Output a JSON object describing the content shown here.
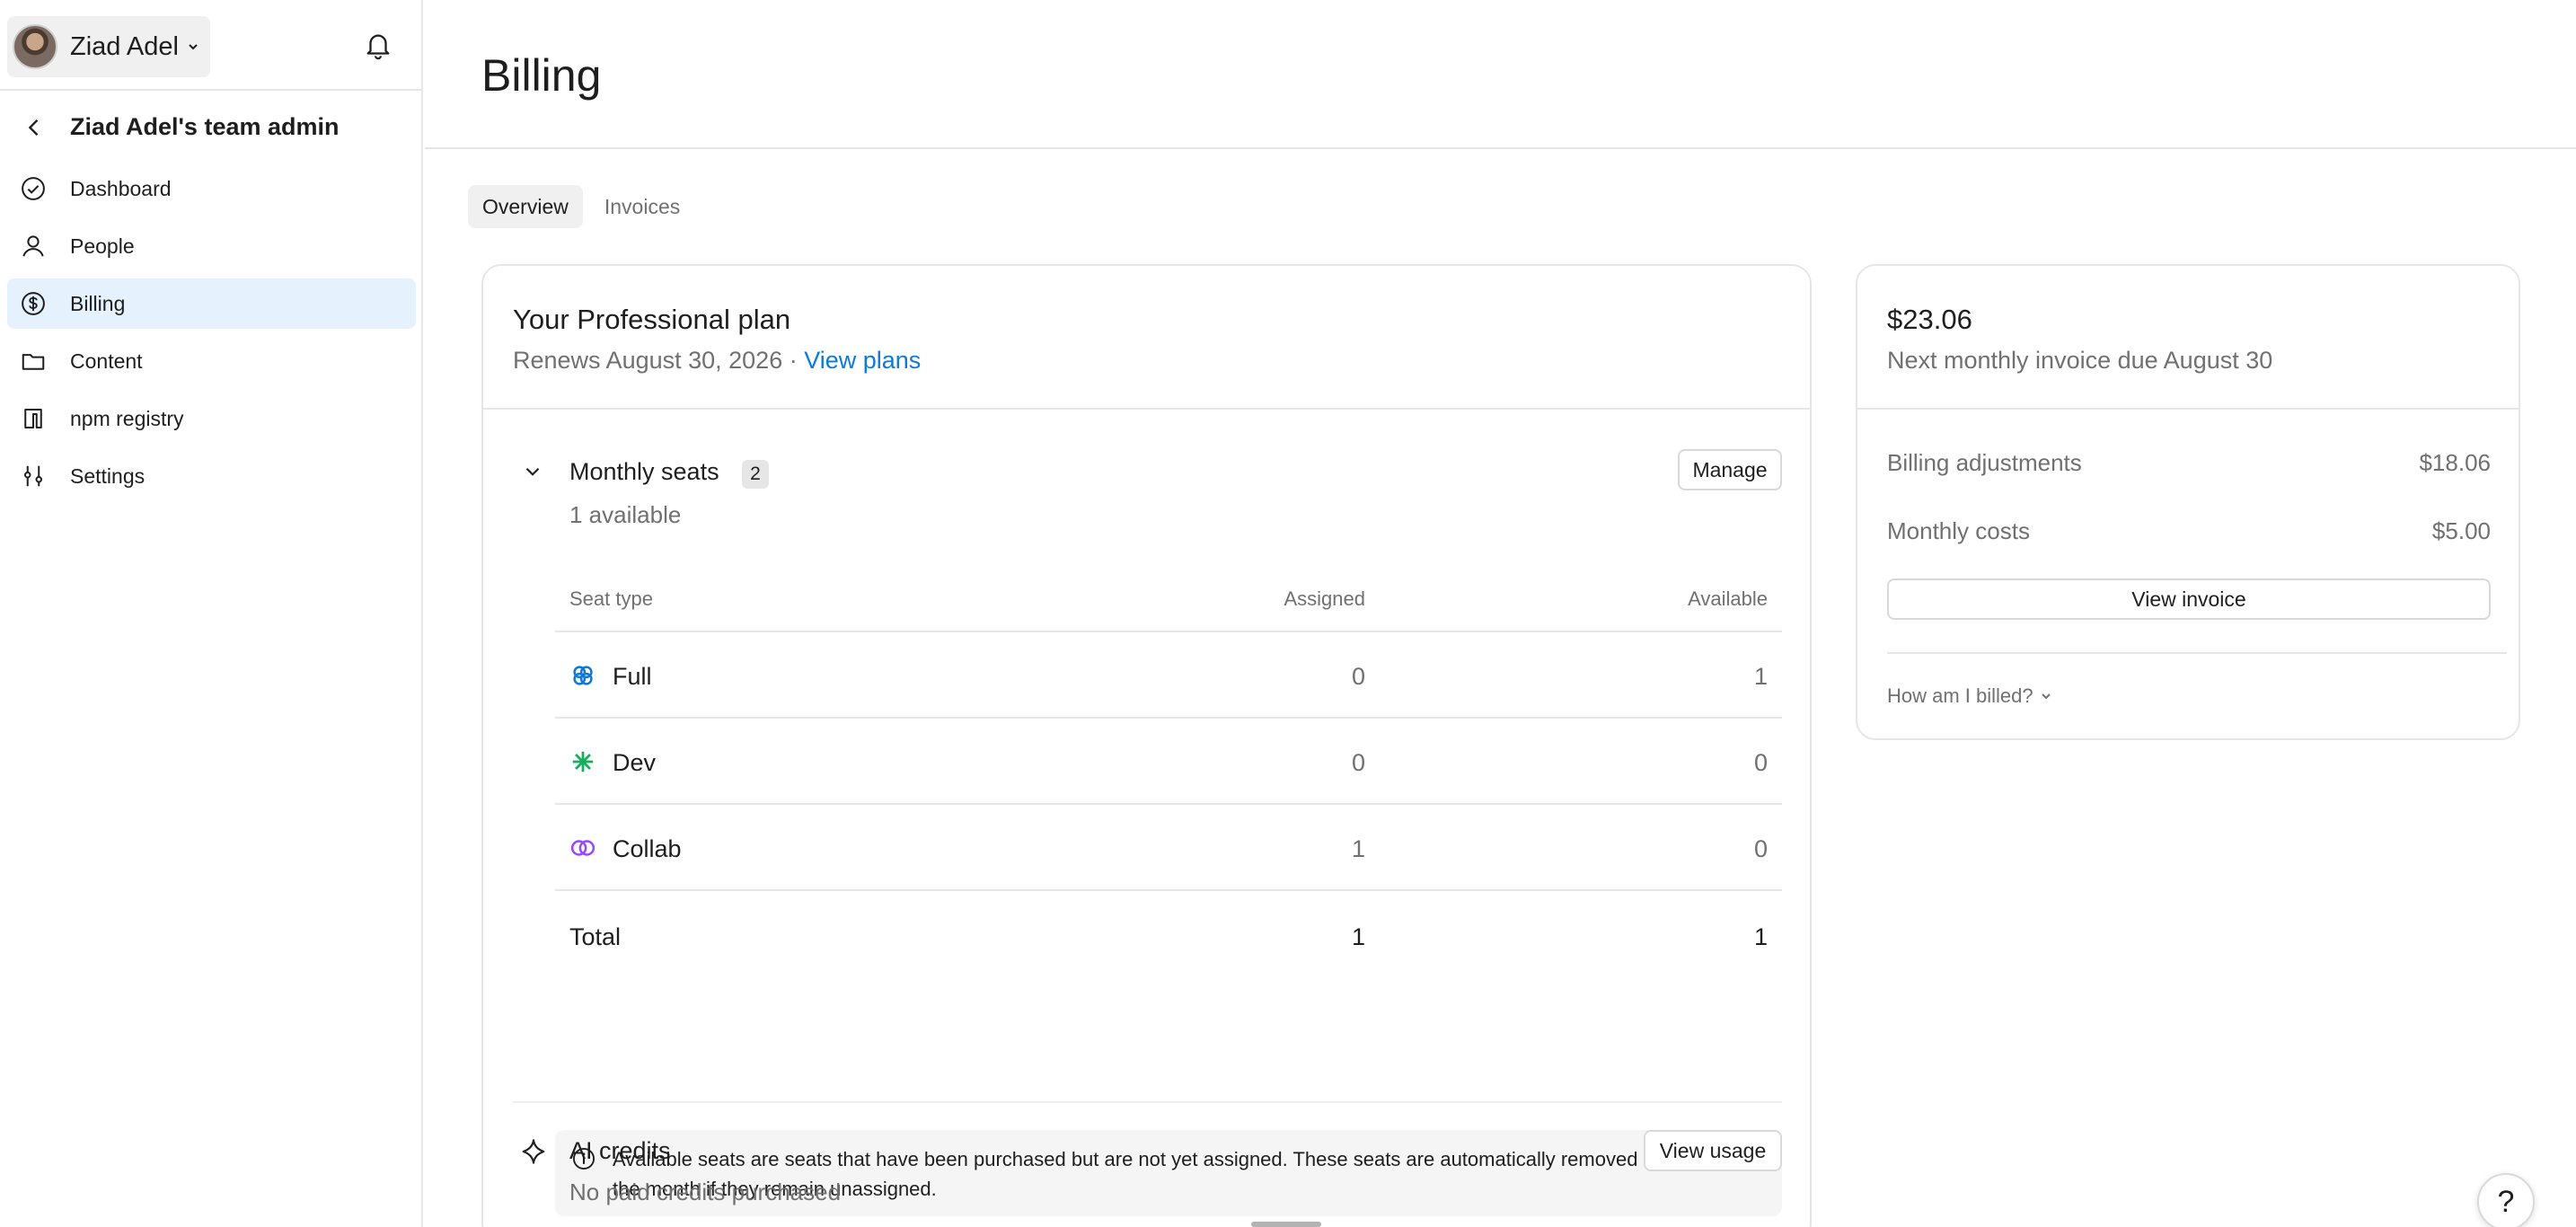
{
  "user": {
    "name": "Ziad Adel"
  },
  "sidebar": {
    "team_title": "Ziad Adel's team admin",
    "items": [
      {
        "label": "Dashboard",
        "icon": "check-circle-icon",
        "active": false
      },
      {
        "label": "People",
        "icon": "person-icon",
        "active": false
      },
      {
        "label": "Billing",
        "icon": "dollar-circle-icon",
        "active": true
      },
      {
        "label": "Content",
        "icon": "folder-icon",
        "active": false
      },
      {
        "label": "npm registry",
        "icon": "npm-icon",
        "active": false
      },
      {
        "label": "Settings",
        "icon": "sliders-icon",
        "active": false
      }
    ]
  },
  "page": {
    "title": "Billing"
  },
  "tabs": [
    {
      "label": "Overview",
      "active": true
    },
    {
      "label": "Invoices",
      "active": false
    }
  ],
  "plan": {
    "title": "Your Professional plan",
    "renews": "Renews August 30, 2026 · ",
    "view_plans": "View plans"
  },
  "seats": {
    "title": "Monthly seats",
    "count": "2",
    "available": "1 available",
    "manage_label": "Manage",
    "headers": {
      "type": "Seat type",
      "assigned": "Assigned",
      "available": "Available"
    },
    "rows": [
      {
        "name": "Full",
        "assigned": "0",
        "available": "1",
        "icon": "full-seat-icon",
        "color": "#0d7ad6"
      },
      {
        "name": "Dev",
        "assigned": "0",
        "available": "0",
        "icon": "dev-seat-icon",
        "color": "#14ae5c"
      },
      {
        "name": "Collab",
        "assigned": "1",
        "available": "0",
        "icon": "collab-seat-icon",
        "color": "#9747ff"
      }
    ],
    "total": {
      "name": "Total",
      "assigned": "1",
      "available": "1"
    },
    "note": "Available seats are seats that have been purchased but are not yet assigned. These seats are automatically removed at the end of the month if they remain unassigned."
  },
  "ai_credits": {
    "title": "AI credits",
    "subtitle": "No paid credits purchased",
    "button": "View usage"
  },
  "invoice": {
    "amount": "$23.06",
    "due": "Next monthly invoice due August 30",
    "adjustments_label": "Billing adjustments",
    "adjustments_value": "$18.06",
    "costs_label": "Monthly costs",
    "costs_value": "$5.00",
    "view_button": "View invoice",
    "billed_link": "How am I billed?"
  },
  "help": {
    "label": "?"
  }
}
